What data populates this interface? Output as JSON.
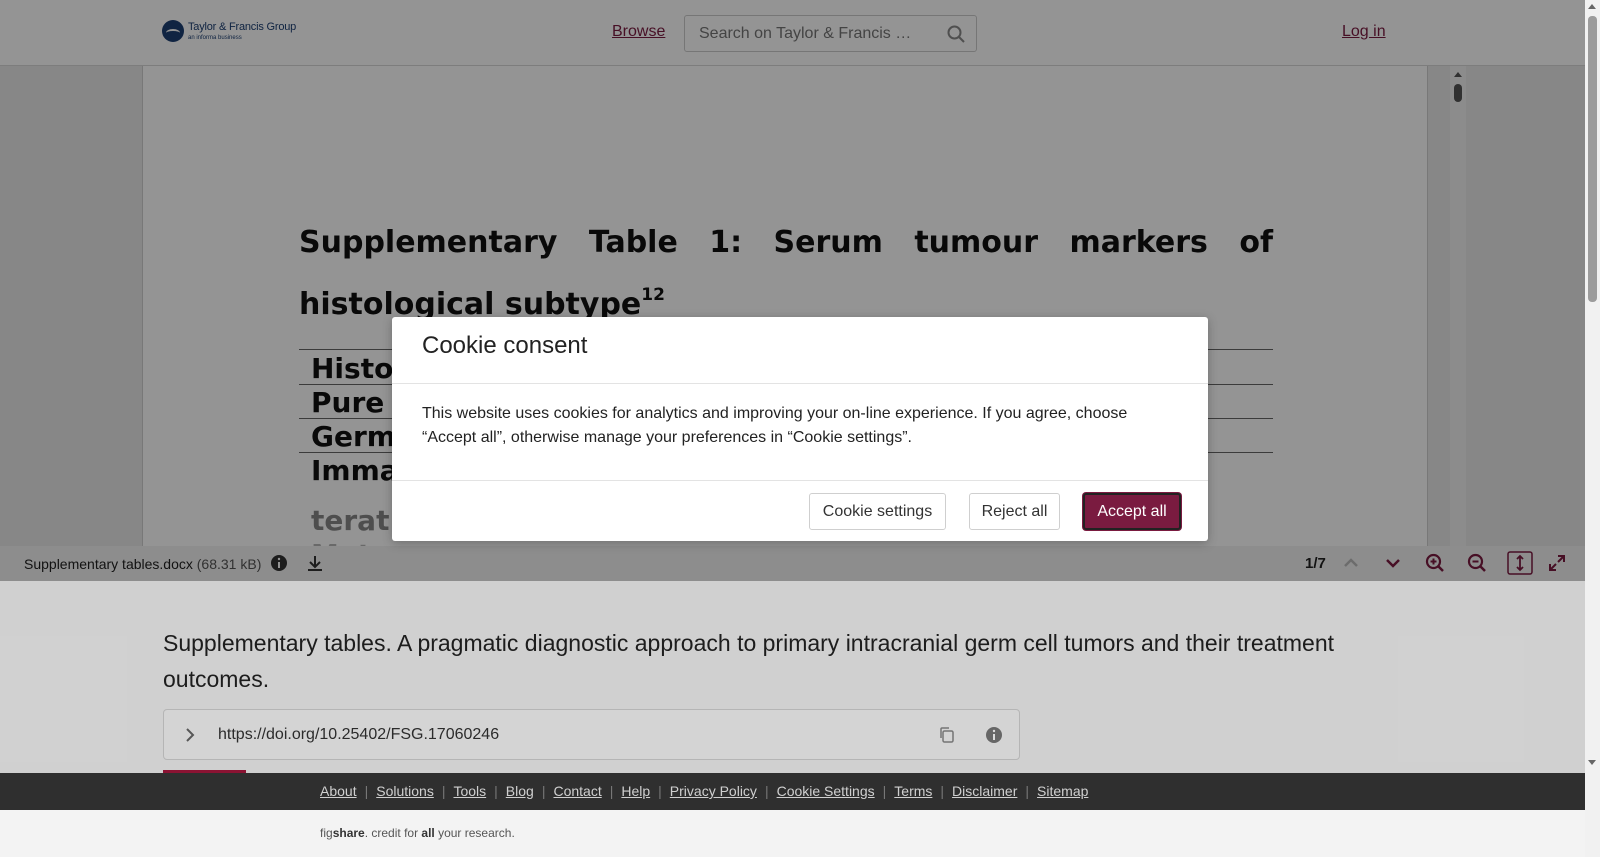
{
  "header": {
    "logo_name": "Taylor & Francis Group",
    "logo_sub": "an informa business",
    "browse_label": "Browse",
    "search_placeholder": "Search on Taylor & Francis …",
    "login_label": "Log in"
  },
  "document": {
    "title": "Supplementary Table 1: Serum tumour markers of histological subtype",
    "title_superscript": "12",
    "rows": [
      "Histo",
      "Pure",
      "Germ",
      "Imma",
      "terat",
      "Matur"
    ]
  },
  "viewer_bar": {
    "file_name": "Supplementary tables.docx",
    "file_size": "(68.31 kB)",
    "page_indicator": "1/7"
  },
  "item": {
    "title": "Supplementary tables. A pragmatic diagnostic approach to primary intracranial germ cell tumors and their treatment outcomes.",
    "doi": "https://doi.org/10.25402/FSG.17060246"
  },
  "footer": {
    "links": [
      "About",
      "Solutions",
      "Tools",
      "Blog",
      "Contact",
      "Help",
      "Privacy Policy",
      "Cookie Settings",
      "Terms",
      "Disclaimer",
      "Sitemap"
    ],
    "credit_prefix": "fig",
    "credit_brand": "share",
    "credit_middle": ". credit for ",
    "credit_all": "all",
    "credit_suffix": " your research."
  },
  "cookie_modal": {
    "title": "Cookie consent",
    "body": "This website uses cookies for analytics and improving your on-line experience. If you agree, choose “Accept all”, otherwise manage your preferences in “Cookie settings”.",
    "settings_label": "Cookie settings",
    "reject_label": "Reject all",
    "accept_label": "Accept all"
  },
  "colors": {
    "accent": "#7a1b40",
    "footer_bg": "#2f2f2f",
    "overlay": "rgba(0,0,0,0.42)"
  },
  "icons": [
    "search-icon",
    "info-icon",
    "download-icon",
    "chevron-up-icon",
    "chevron-down-icon",
    "zoom-in-icon",
    "zoom-out-icon",
    "fit-height-icon",
    "fullscreen-icon",
    "chevron-right-icon",
    "copy-icon"
  ]
}
